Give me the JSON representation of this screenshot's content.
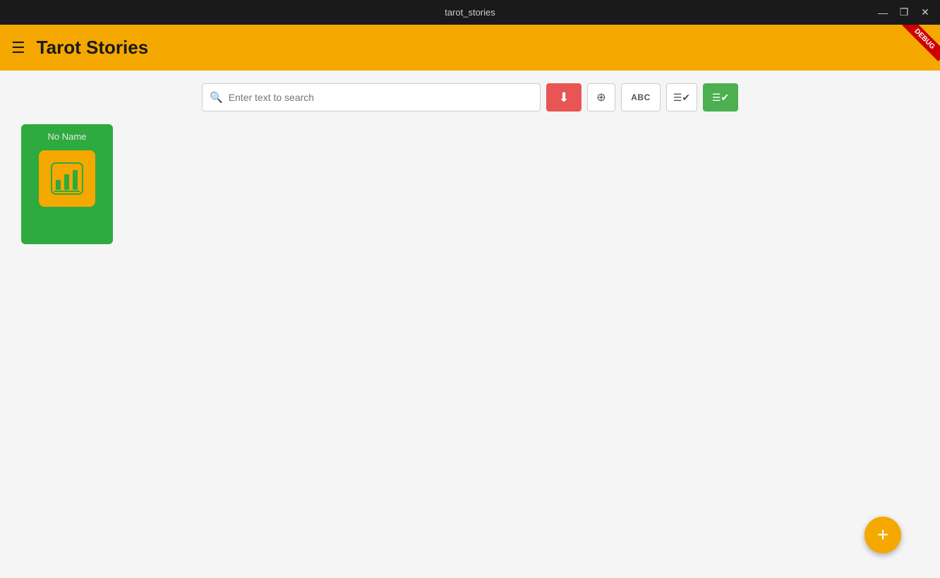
{
  "window": {
    "title": "tarot_stories",
    "minimize_label": "—",
    "maximize_label": "❐",
    "close_label": "✕"
  },
  "appbar": {
    "menu_icon": "☰",
    "app_title": "Tarot Stories",
    "debug_label": "DEBUG"
  },
  "toolbar": {
    "search_placeholder": "Enter text to search",
    "btn_download_icon": "⬇",
    "btn_add_icon": "⊕",
    "btn_abc_label": "ABC",
    "btn_check_all_icon": "✔",
    "btn_check_green_icon": "✔✔"
  },
  "cards": [
    {
      "name": "No Name",
      "icon_label": "chart-icon"
    }
  ],
  "fab": {
    "label": "+"
  }
}
